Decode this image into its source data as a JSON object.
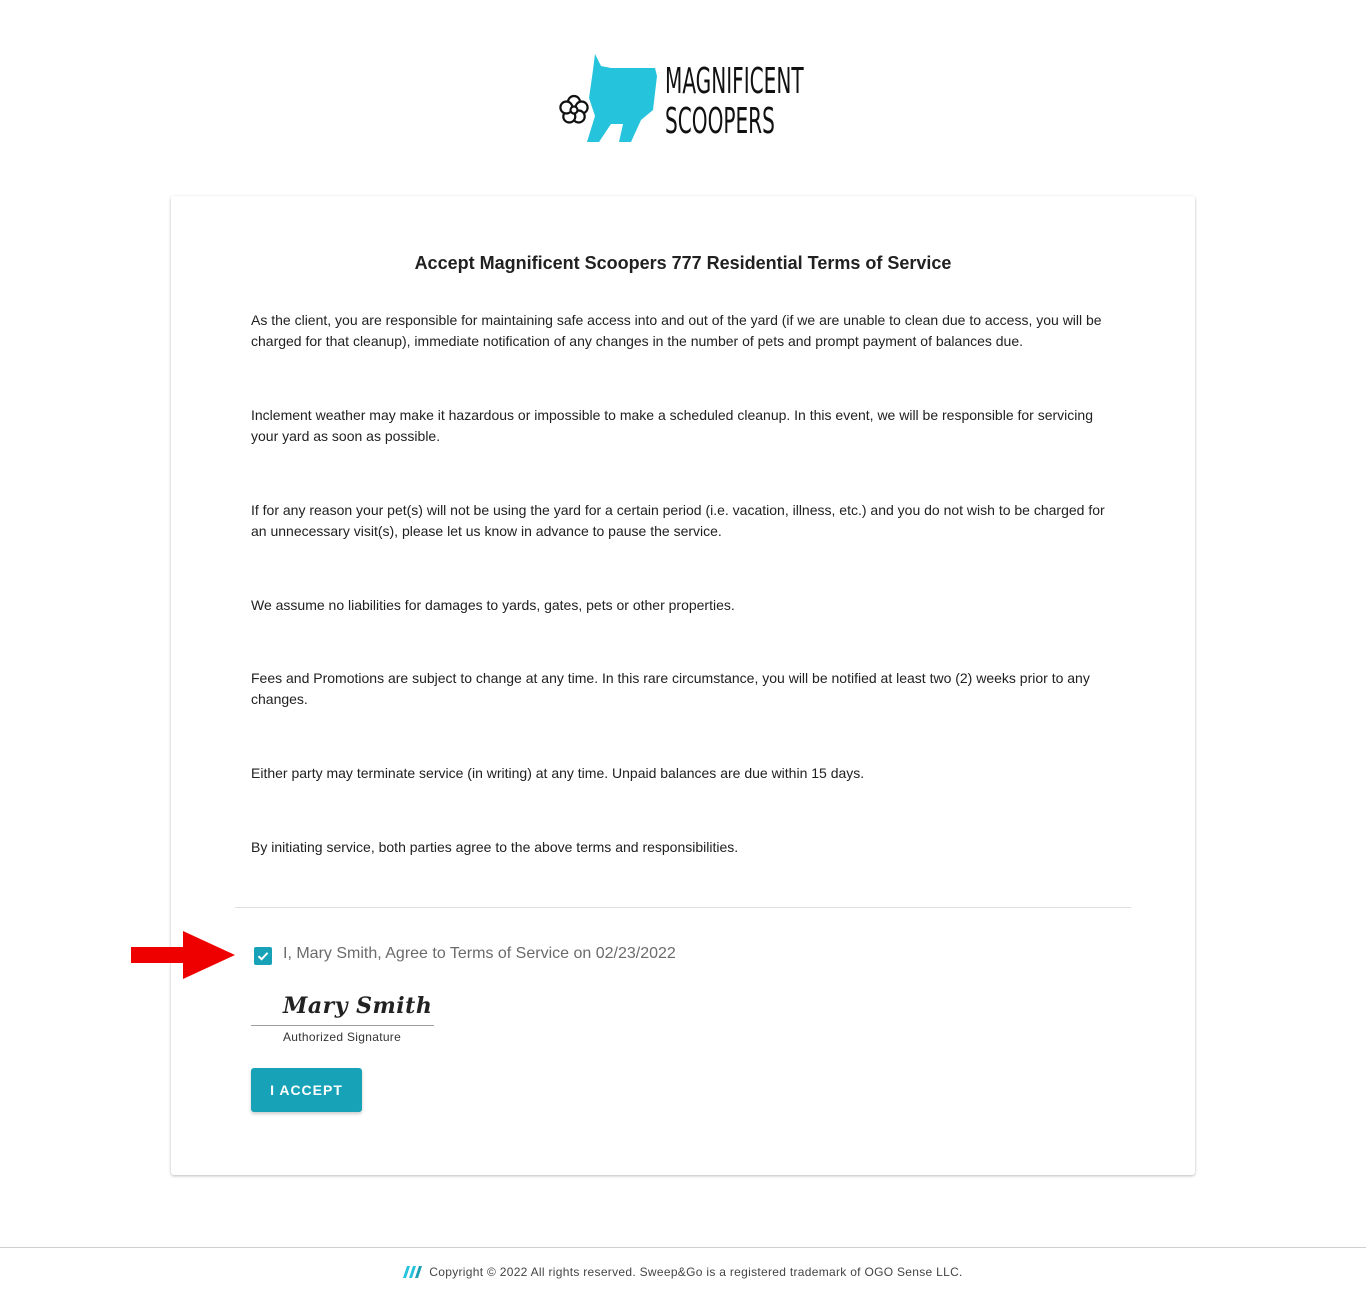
{
  "logo": {
    "line1": "MAGNIFICENT",
    "line2": "SCOOPERS",
    "accent_color": "#26c3dc"
  },
  "card": {
    "title": "Accept Magnificent Scoopers 777 Residential Terms of Service",
    "paragraphs": [
      "As the client, you are responsible for maintaining safe access into and out of the yard (if we are unable to clean due to access, you will be charged for that cleanup), immediate notification of any changes in the number of pets and prompt payment of balances due.",
      "Inclement weather may make it hazardous or impossible to make a scheduled cleanup. In this event, we will be responsible for servicing your yard as soon as possible.",
      "If for any reason your pet(s) will not be using the yard for a certain period (i.e. vacation, illness, etc.) and you do not wish to be charged for an unnecessary visit(s), please let us know in advance to pause the service.",
      "We assume no liabilities for damages to yards, gates, pets or other properties.",
      "Fees and Promotions are subject to change at any time. In this rare circumstance, you will be notified at least two (2) weeks prior to any changes.",
      "Either party may terminate service (in writing) at any time. Unpaid balances are due within 15 days.",
      "By initiating service, both parties agree to the above terms and responsibilities."
    ],
    "agree_checked": true,
    "agree_label": "I, Mary Smith, Agree to Terms of Service on 02/23/2022",
    "signature_name": "Mary Smith",
    "signature_caption": "Authorized Signature",
    "accept_button": "I ACCEPT"
  },
  "annotation": {
    "arrow_color": "#ee0000",
    "arrow_icon": "right-arrow-icon"
  },
  "footer": {
    "icon": "sweepandgo-icon",
    "text": "Copyright © 2022 All rights reserved. Sweep&Go is a registered trademark of OGO Sense LLC."
  },
  "colors": {
    "primary": "#17a2b8",
    "text": "#212121"
  }
}
